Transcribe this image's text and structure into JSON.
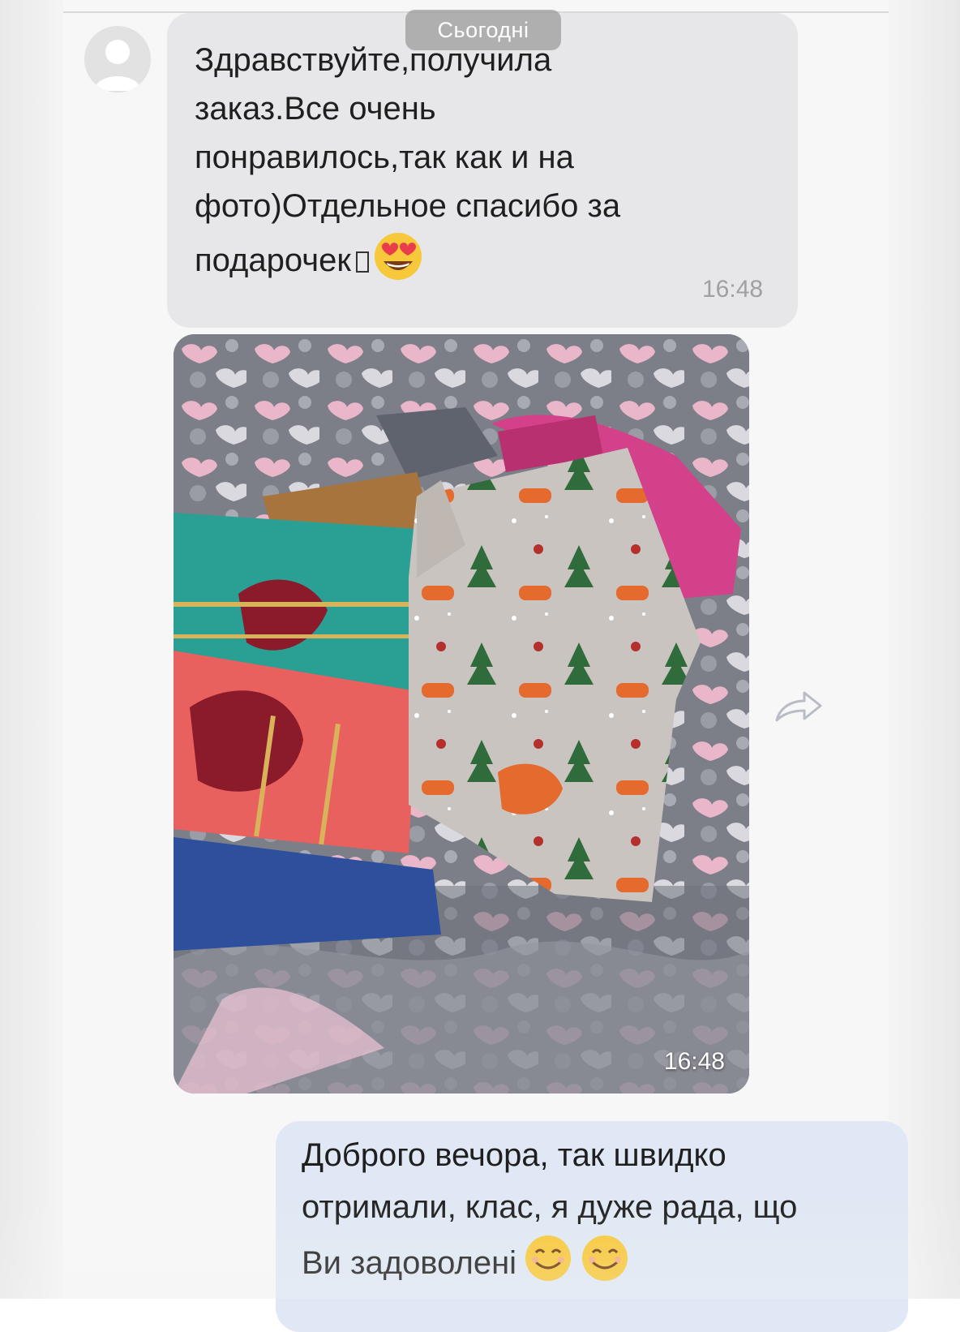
{
  "header": {
    "date_chip": "Сьогодні"
  },
  "incoming": {
    "lines": [
      "Здравствуйте,получила",
      "заказ.Все очень",
      "понравилось,так как и на",
      "фото)Отдельное спасибо за",
      "подарочек"
    ],
    "emoji_1": "heart-eyes-emoji",
    "time": "16:48"
  },
  "photo": {
    "time": "16:48",
    "description_icon": "towels-photo"
  },
  "outgoing": {
    "lines": [
      "Доброго вечора, так швидко",
      "отримали, клас, я дуже рада, що",
      "Ви задоволені"
    ],
    "emoji": "smiling-face-emoji"
  },
  "icons": {
    "share": "share-icon",
    "avatar": "avatar-icon"
  },
  "colors": {
    "incoming_bubble": "#e7e7ea",
    "outgoing_bubble": "#dfe8f4",
    "date_chip": "#8c8c8c"
  }
}
